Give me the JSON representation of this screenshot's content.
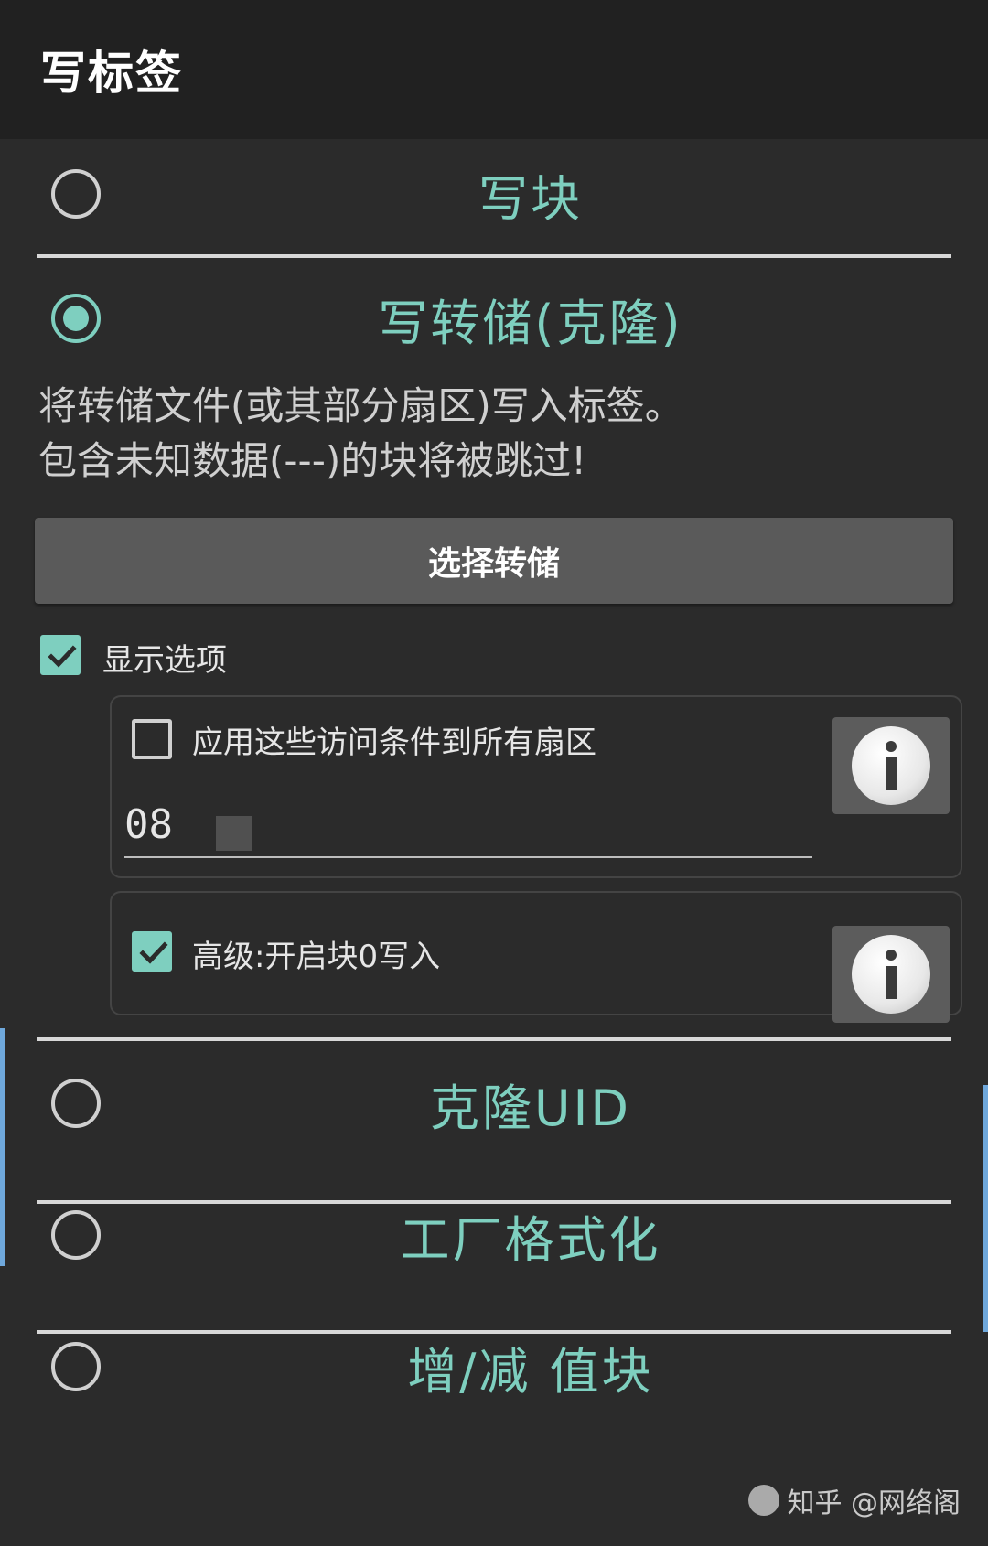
{
  "appbar": {
    "title": "写标签"
  },
  "options": [
    {
      "label": "写块",
      "checked": false
    },
    {
      "label": "写转储(克隆)",
      "checked": true
    },
    {
      "label": "克隆UID",
      "checked": false
    },
    {
      "label": "工厂格式化",
      "checked": false
    },
    {
      "label": "增/减 值块",
      "checked": false
    }
  ],
  "clone_section": {
    "description_line1": "将转储文件(或其部分扇区)写入标签。",
    "description_line2": "包含未知数据(---)的块将被跳过!",
    "select_dump_label": "选择转储",
    "show_options": {
      "label": "显示选项",
      "checked": true
    },
    "access_panel": {
      "apply_all_label": "应用这些访问条件到所有扇区",
      "apply_all_checked": false,
      "access_bits_value": "08"
    },
    "advanced_panel": {
      "block0_label": "高级:开启块0写入",
      "block0_checked": true
    }
  },
  "watermark": {
    "text": "知乎 @网络阁"
  },
  "colors": {
    "accent": "#7ecfbf",
    "background": "#2b2b2b",
    "appbar": "#212121",
    "button": "#5a5a5a"
  }
}
